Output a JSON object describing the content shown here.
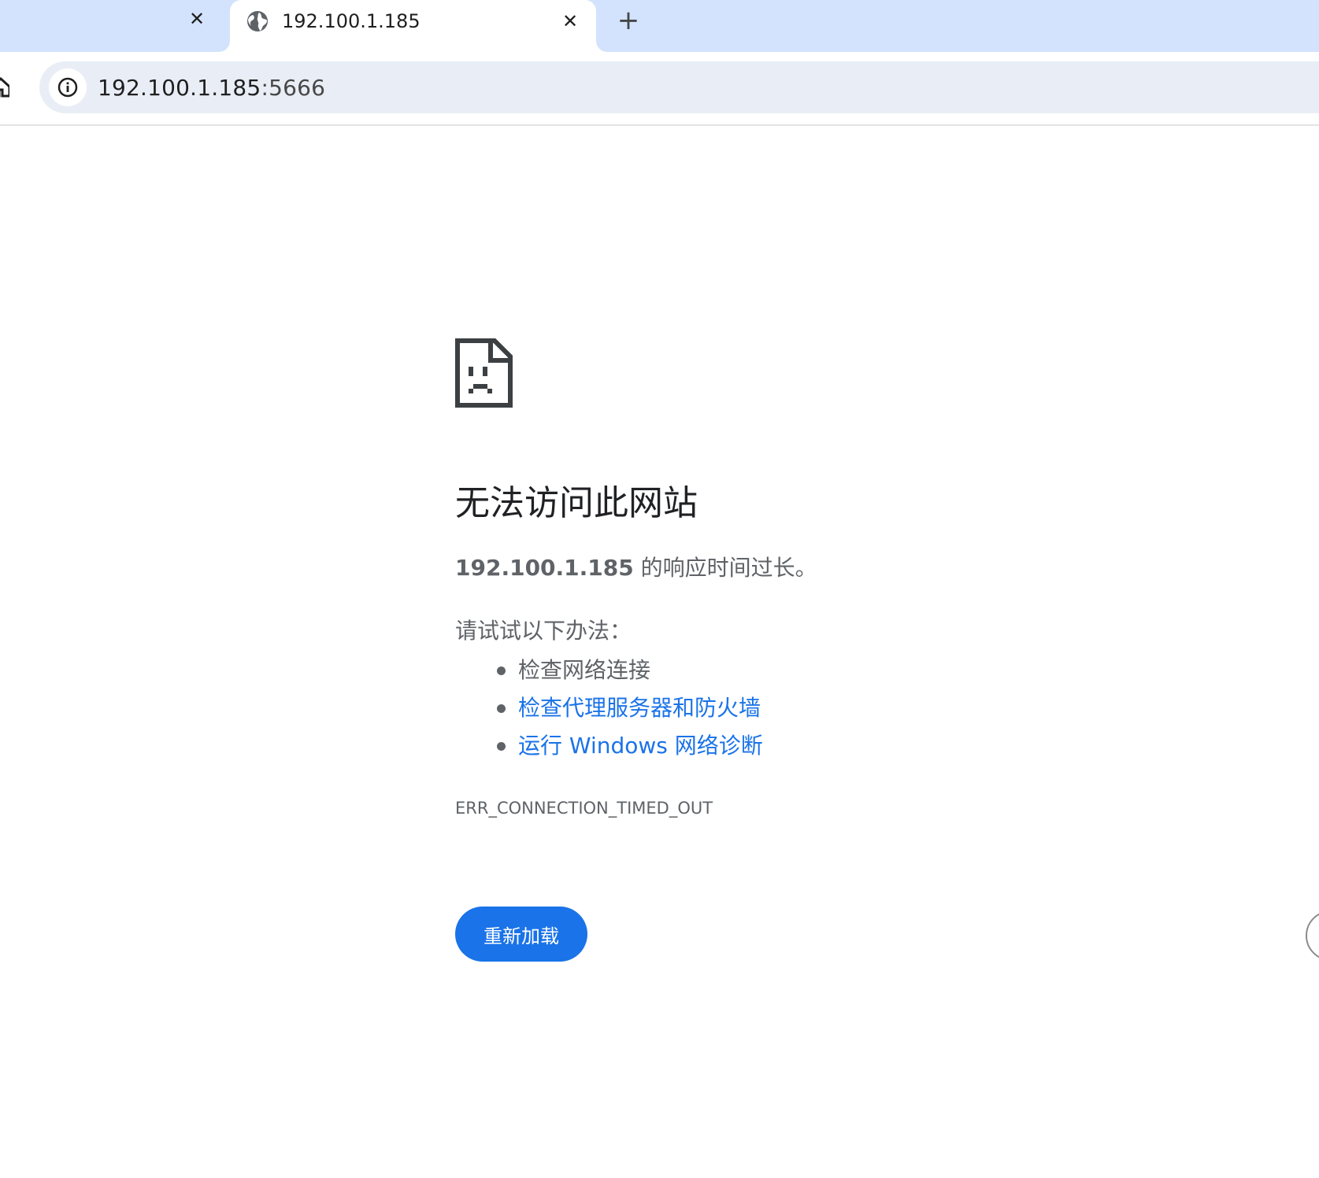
{
  "tabs": {
    "active_title": "192.100.1.185",
    "close_glyph": "✕",
    "new_tab_glyph": "+"
  },
  "toolbar": {
    "url_host": "192.100.1.185",
    "url_port": ":5666",
    "site_info_icon": "info-icon",
    "home_icon": "home-icon"
  },
  "error_page": {
    "icon": "sad-document-icon",
    "heading": "无法访问此网站",
    "summary_host": "192.100.1.185",
    "summary_text": " 的响应时间过长。",
    "suggestions_title": "请试试以下办法：",
    "suggestions": [
      {
        "label": "检查网络连接",
        "link": false
      },
      {
        "label": "检查代理服务器和防火墙",
        "link": true
      },
      {
        "label": "运行 Windows 网络诊断",
        "link": true
      }
    ],
    "error_code": "ERR_CONNECTION_TIMED_OUT",
    "reload_label": "重新加载"
  },
  "colors": {
    "tab_strip": "#d3e3fd",
    "omnibox": "#e9eef6",
    "link": "#1a73e8",
    "button": "#1a73e8",
    "text_secondary": "#5f6368",
    "heading": "#202124"
  }
}
